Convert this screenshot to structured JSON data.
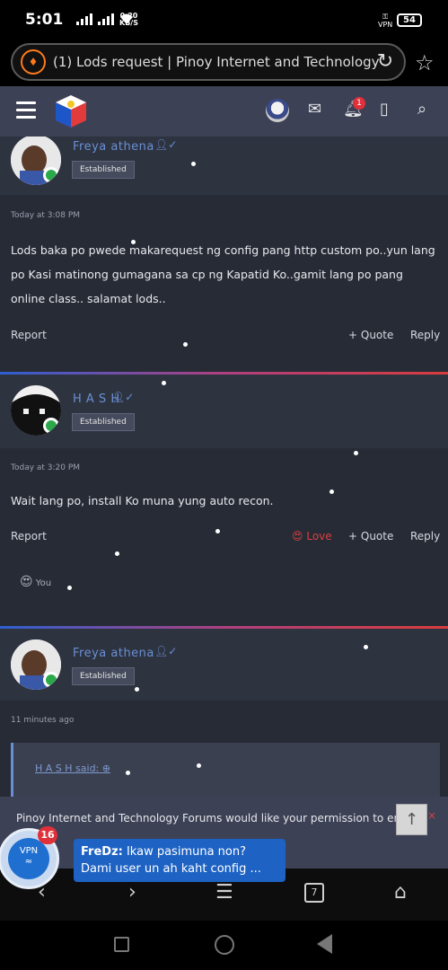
{
  "status_bar": {
    "time": "5:01",
    "speed_value": "0.20",
    "speed_unit": "KB/S",
    "vpn_label": "VPN",
    "battery": "54"
  },
  "browser": {
    "url_title": "(1) Lods request | Pinoy Internet and Technology",
    "site_icon": "fire-icon",
    "tab_count": "7"
  },
  "forum_header": {
    "notification_count": "1"
  },
  "posts": [
    {
      "username": "Freya athena",
      "badge": "Established",
      "timestamp": "Today at 3:08 PM",
      "body": "Lods baka po pwede makarequest ng config pang http custom po..yun lang po Kasi matinong gumagana sa cp ng Kapatid Ko..gamit lang po pang online class.. salamat lods..",
      "report": "Report",
      "quote": "+ Quote",
      "reply": "Reply"
    },
    {
      "username": "H A S H",
      "badge": "Established",
      "timestamp": "Today at 3:20 PM",
      "body": "Wait lang po, install Ko muna yung auto recon.",
      "report": "Report",
      "love": "Love",
      "quote": "+ Quote",
      "reply": "Reply",
      "reaction_by": "You"
    },
    {
      "username": "Freya athena",
      "badge": "Established",
      "timestamp": "11 minutes ago",
      "quote_author": "H A S H said:"
    }
  ],
  "permission_prompt": {
    "text": "Pinoy Internet and Technology Forums would like your permission to enable push notifications",
    "scroll_top": "↑",
    "close": "×"
  },
  "chat_head": {
    "vpn_label": "VPN",
    "count": "16",
    "sender": "FreDz:",
    "message": " Ikaw pasimuna non? Dami user un ah kaht config ..."
  },
  "colors": {
    "accent_blue": "#6a8fd4",
    "header_bg": "#3c4155",
    "content_bg": "#262b36",
    "online_green": "#2ba84a",
    "love_red": "#d84040"
  }
}
